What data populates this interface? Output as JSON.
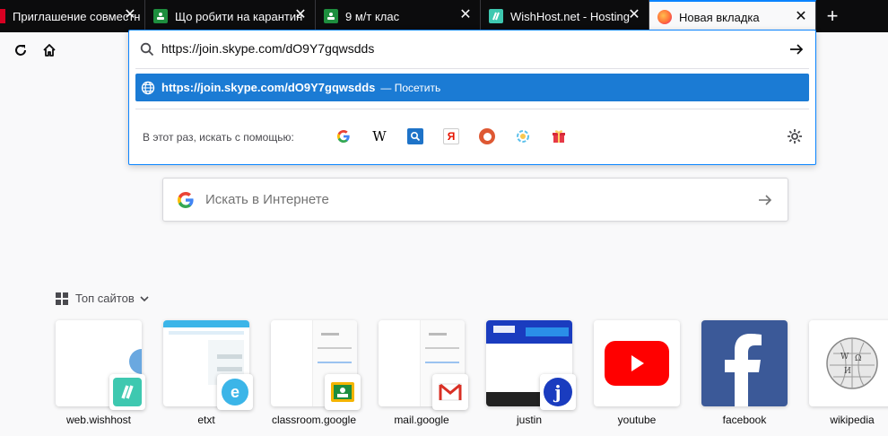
{
  "tabs": [
    {
      "title": "Приглашение совместн",
      "favicon": "red-square-icon",
      "color": "#d70022"
    },
    {
      "title": "Що робити на карантин",
      "favicon": "classroom-icon",
      "color": "#1e8e3e"
    },
    {
      "title": "9 м/т клас",
      "favicon": "classroom-icon",
      "color": "#1e8e3e"
    },
    {
      "title": "WishHost.net - Hosting",
      "favicon": "wishhost-icon",
      "color": "#3ec8b0"
    },
    {
      "title": "Новая вкладка",
      "favicon": "firefox-icon",
      "color": "#ff7139"
    }
  ],
  "urlbar": {
    "value": "https://join.skype.com/dO9Y7gqwsdds",
    "result_url": "https://join.skype.com/dO9Y7gqwsdds",
    "result_action": "— Посетить",
    "one_off_label": "В этот раз, искать с помощью:",
    "engines": [
      "google-icon",
      "wikipedia-icon",
      "search-engine-icon",
      "yandex-icon",
      "duckduckgo-icon",
      "engine-icon",
      "gift-icon"
    ]
  },
  "search": {
    "placeholder": "Искать в Интернете"
  },
  "top_sites": {
    "heading": "Топ сайтов",
    "tiles": [
      {
        "label": "web.wishhost"
      },
      {
        "label": "etxt"
      },
      {
        "label": "classroom.google"
      },
      {
        "label": "mail.google"
      },
      {
        "label": "justin"
      },
      {
        "label": "youtube"
      },
      {
        "label": "facebook"
      },
      {
        "label": "wikipedia"
      }
    ]
  },
  "colors": {
    "accent": "#0a84ff",
    "result_bg": "#1b7bd4",
    "tabstrip_bg": "#0c0c0d"
  }
}
